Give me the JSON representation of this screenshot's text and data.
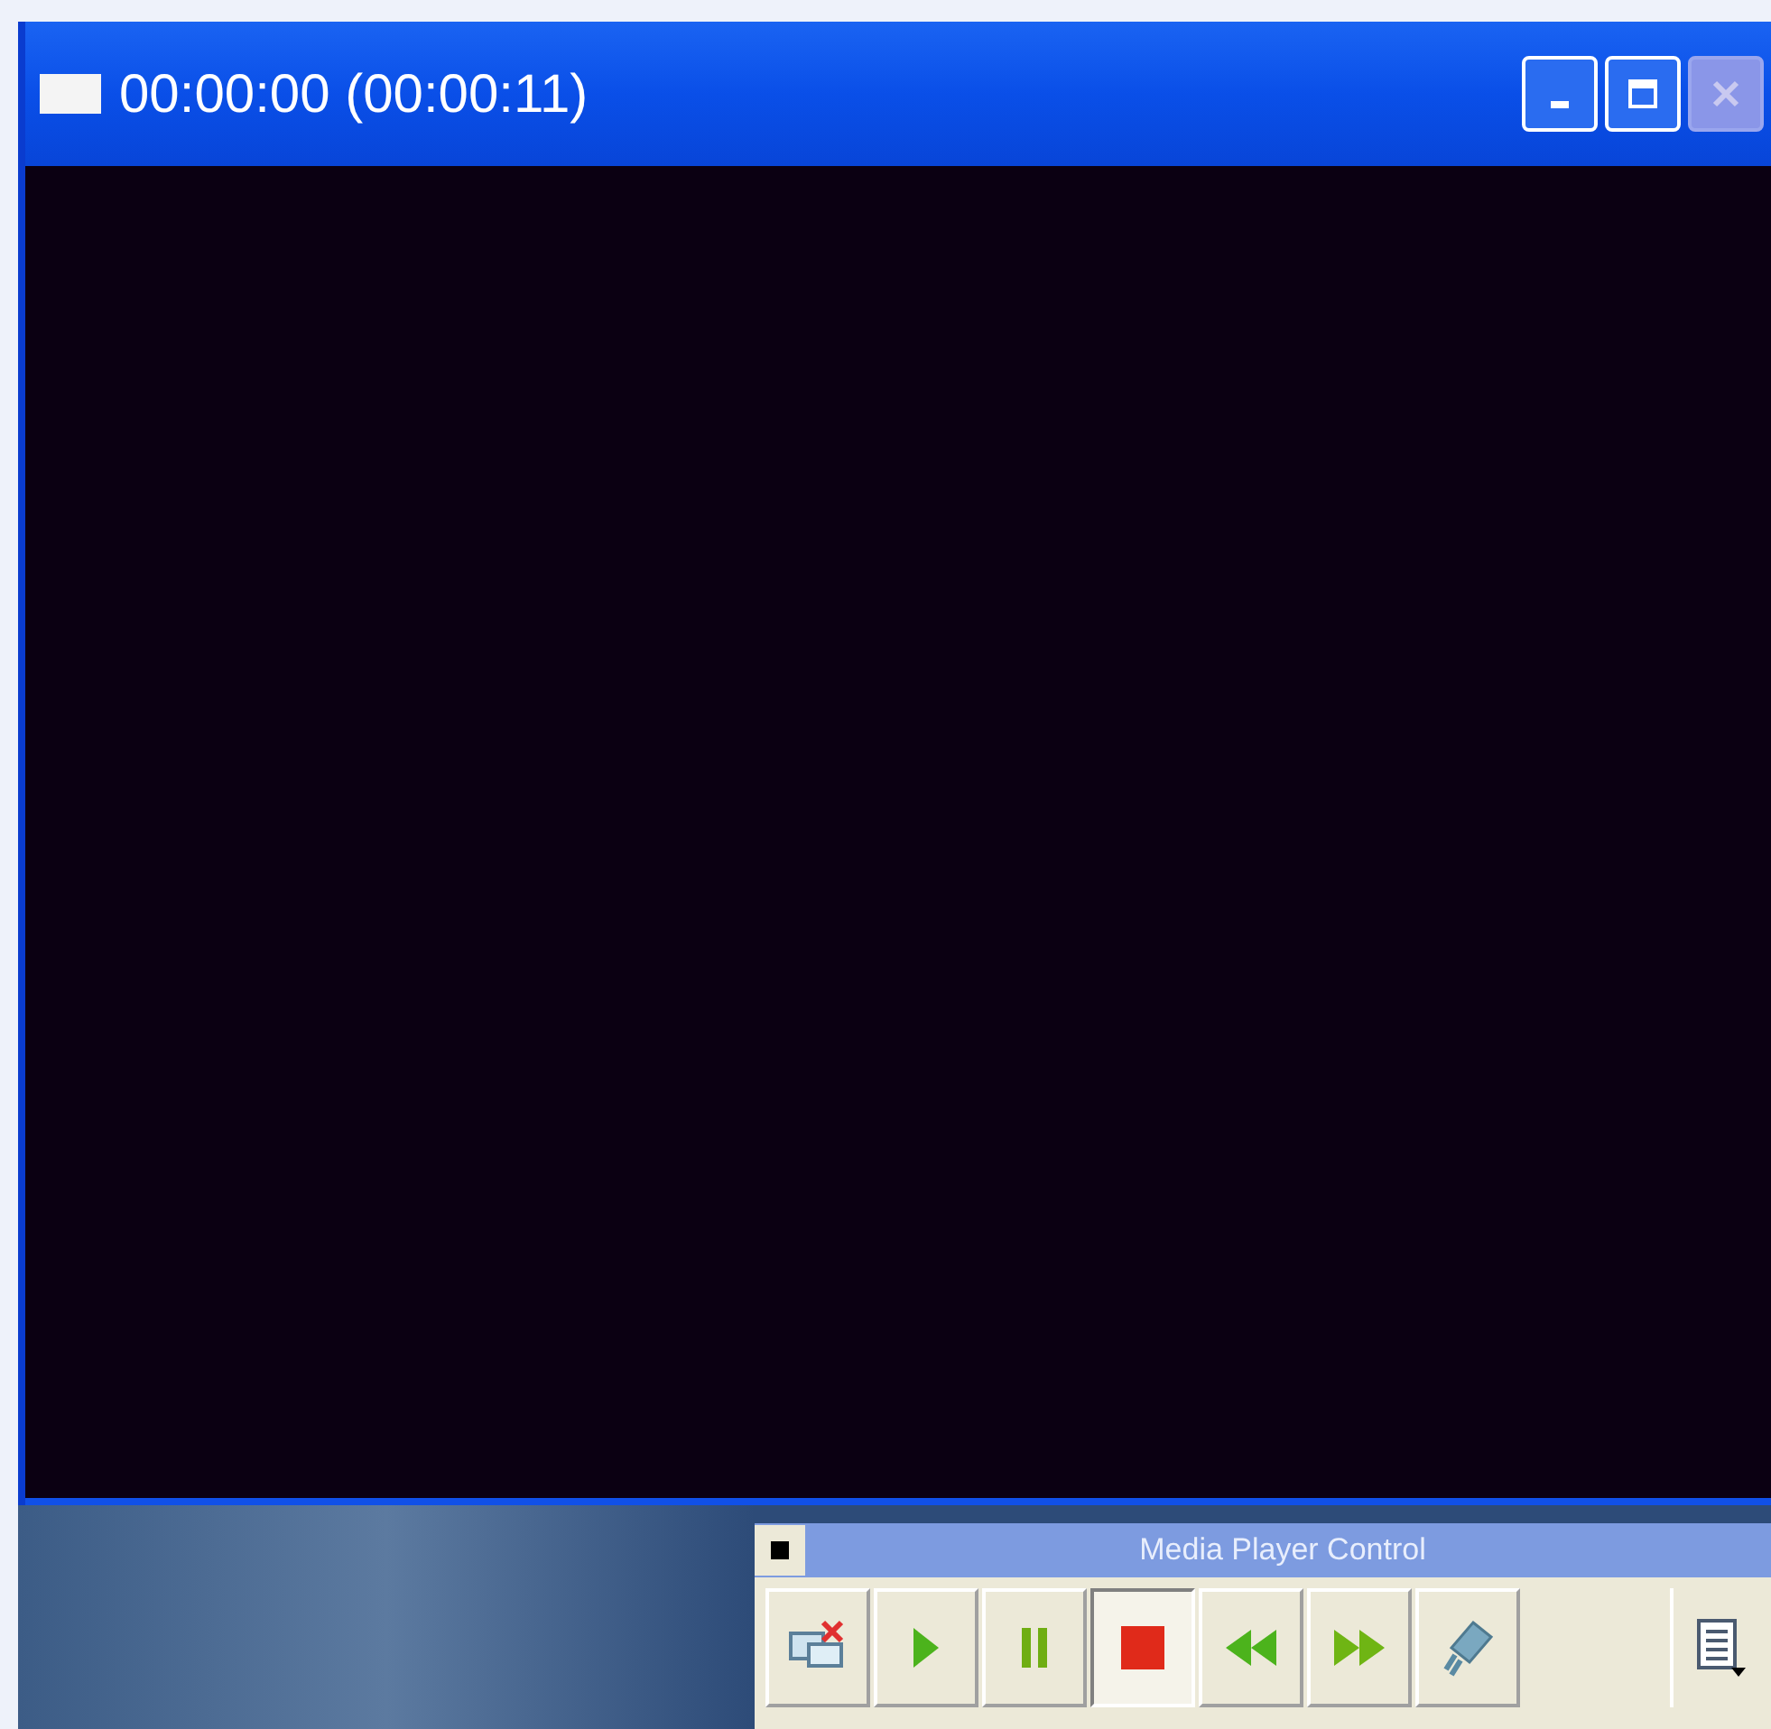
{
  "window": {
    "title": "00:00:00 (00:00:11)",
    "controls": [
      {
        "kind": "minimize",
        "disabled": false
      },
      {
        "kind": "maximize",
        "disabled": false
      },
      {
        "kind": "close",
        "disabled": true
      }
    ]
  },
  "control_panel": {
    "title": "Media Player Control",
    "buttons": [
      {
        "kind": "disconnect",
        "pressed": false
      },
      {
        "kind": "play",
        "pressed": false
      },
      {
        "kind": "pause",
        "pressed": false
      },
      {
        "kind": "stop",
        "pressed": true
      },
      {
        "kind": "rewind",
        "pressed": false
      },
      {
        "kind": "forward",
        "pressed": false
      },
      {
        "kind": "film",
        "pressed": false
      }
    ],
    "menu_button": {
      "kind": "list"
    }
  }
}
